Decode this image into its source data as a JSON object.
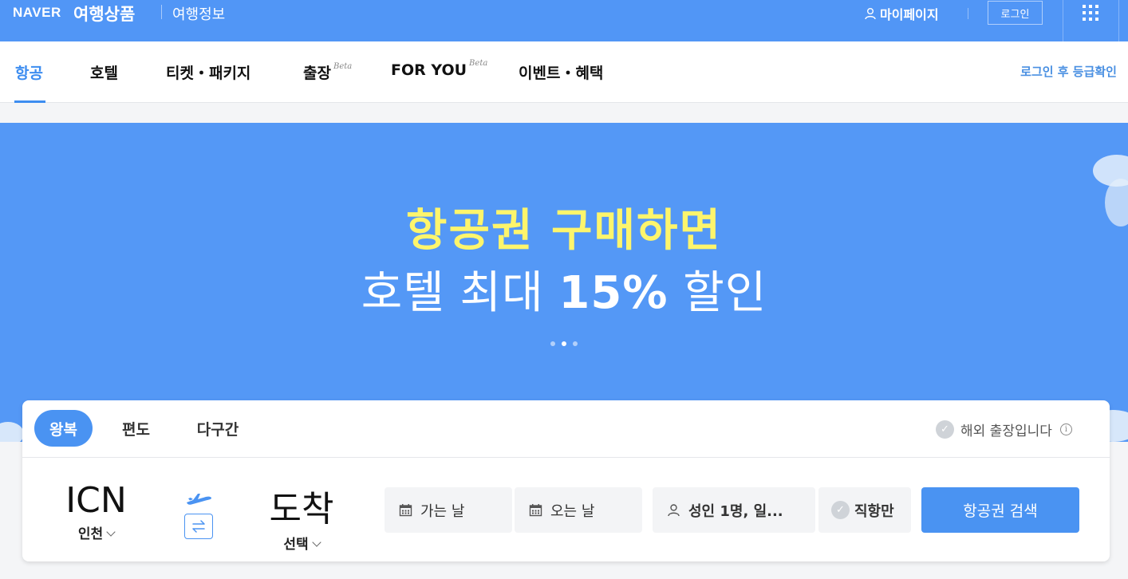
{
  "header": {
    "logo": "NAVER",
    "section_title": "여행상품",
    "info_link": "여행정보",
    "mypage_label": "마이페이지",
    "login_label": "로그인"
  },
  "nav": {
    "items": [
      {
        "label": "항공",
        "beta": ""
      },
      {
        "label": "호텔",
        "beta": ""
      },
      {
        "label": "티켓・패키지",
        "beta": ""
      },
      {
        "label": "출장",
        "beta": "Beta"
      },
      {
        "label": "FOR YOU",
        "beta": "Beta"
      },
      {
        "label": "이벤트・혜택",
        "beta": ""
      }
    ],
    "grade_link": "로그인 후 등급확인"
  },
  "banner": {
    "line1": "항공권 구매하면",
    "line2_prefix": "호텔 최대 ",
    "line2_bold": "15%",
    "line2_suffix": " 할인",
    "slide_count": 3,
    "active_slide": 2
  },
  "search": {
    "trip_types": [
      "왕복",
      "편도",
      "다구간"
    ],
    "active_trip_type": "왕복",
    "business_trip_label": "해외 출장입니다",
    "departure": {
      "code": "ICN",
      "city": "인천"
    },
    "arrival": {
      "code": "도착",
      "city": "선택"
    },
    "depart_date_placeholder": "가는 날",
    "return_date_placeholder": "오는 날",
    "passengers": "성인 1명, 일...",
    "direct_only_label": "직항만",
    "search_button": "항공권 검색"
  },
  "colors": {
    "brand_blue": "#5196f6",
    "accent_blue": "#4a93f2",
    "banner_yellow": "#fdf56c"
  }
}
